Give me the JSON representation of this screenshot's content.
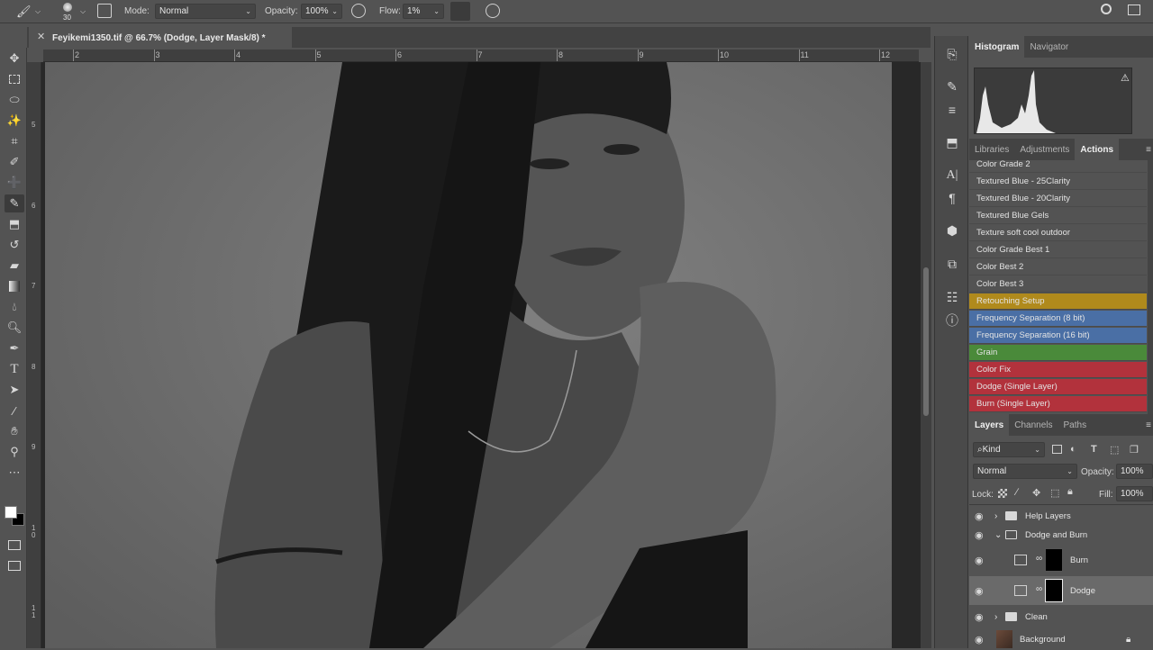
{
  "optionsBar": {
    "brushSize": "30",
    "modeLabel": "Mode:",
    "modeValue": "Normal",
    "opacityLabel": "Opacity:",
    "opacityValue": "100%",
    "flowLabel": "Flow:",
    "flowValue": "1%"
  },
  "document": {
    "tabTitle": "Feyikemi1350.tif @ 66.7% (Dodge, Layer Mask/8) *",
    "rulerTop": [
      "2",
      "3",
      "4",
      "5",
      "6",
      "7",
      "8",
      "9",
      "10",
      "11",
      "12"
    ],
    "rulerLeft": [
      "5",
      "6",
      "7",
      "8",
      "9",
      "1\n0",
      "1\n1"
    ]
  },
  "histogramPanel": {
    "tabs": [
      "Histogram",
      "Navigator"
    ],
    "activeTab": "Histogram"
  },
  "actionsPanel": {
    "tabs": [
      "Libraries",
      "Adjustments",
      "Actions"
    ],
    "activeTab": "Actions",
    "items": [
      {
        "label": "Color Grade 2",
        "color": "#535353"
      },
      {
        "label": "Textured Blue - 25Clarity",
        "color": "#535353"
      },
      {
        "label": "Textured Blue - 20Clarity",
        "color": "#535353"
      },
      {
        "label": "Textured Blue Gels",
        "color": "#535353"
      },
      {
        "label": "Texture soft cool outdoor",
        "color": "#535353"
      },
      {
        "label": "Color Grade Best 1",
        "color": "#535353"
      },
      {
        "label": "Color Best 2",
        "color": "#535353"
      },
      {
        "label": "Color Best 3",
        "color": "#535353"
      },
      {
        "label": "Retouching Setup",
        "color": "#b08a1c"
      },
      {
        "label": "Frequency Separation (8 bit)",
        "color": "#4a6fa5"
      },
      {
        "label": "Frequency Separation (16 bit)",
        "color": "#4a6fa5"
      },
      {
        "label": "Grain",
        "color": "#4a8a3a"
      },
      {
        "label": "Color Fix",
        "color": "#b2323c"
      },
      {
        "label": "Dodge (Single Layer)",
        "color": "#b2323c"
      },
      {
        "label": "Burn (Single Layer)",
        "color": "#b2323c"
      }
    ]
  },
  "layersPanel": {
    "tabs": [
      "Layers",
      "Channels",
      "Paths"
    ],
    "activeTab": "Layers",
    "filterKind": "Kind",
    "blendMode": "Normal",
    "opacityLabel": "Opacity:",
    "opacityValue": "100%",
    "lockLabel": "Lock:",
    "fillLabel": "Fill:",
    "fillValue": "100%",
    "layers": [
      {
        "name": "Help Layers",
        "type": "group",
        "expanded": false
      },
      {
        "name": "Dodge and Burn",
        "type": "group",
        "expanded": true
      },
      {
        "name": "Burn",
        "type": "curves"
      },
      {
        "name": "Dodge",
        "type": "curves",
        "selected": true
      },
      {
        "name": "Clean",
        "type": "group",
        "expanded": false
      },
      {
        "name": "Background",
        "type": "pixel",
        "locked": true
      }
    ]
  }
}
